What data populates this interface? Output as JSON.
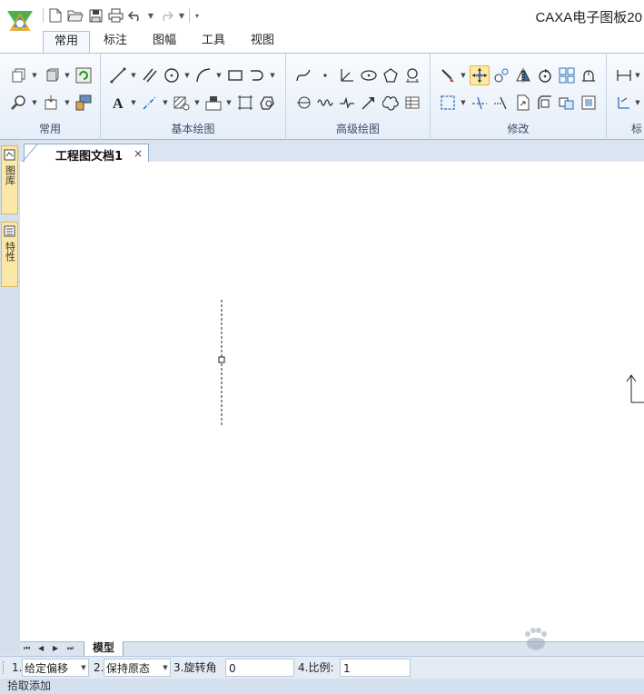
{
  "app": {
    "title": "CAXA电子图板20"
  },
  "quick_access": {
    "new": "new-file-icon",
    "open": "open-folder-icon",
    "save": "save-icon",
    "print": "print-icon",
    "undo": "undo-icon",
    "redo": "redo-icon",
    "customize": "customize-icon"
  },
  "ribbon": {
    "tabs": [
      {
        "label": "常用",
        "active": true
      },
      {
        "label": "标注",
        "active": false
      },
      {
        "label": "图幅",
        "active": false
      },
      {
        "label": "工具",
        "active": false
      },
      {
        "label": "视图",
        "active": false
      }
    ],
    "groups": [
      {
        "label": "常用"
      },
      {
        "label": "基本绘图"
      },
      {
        "label": "高级绘图"
      },
      {
        "label": "修改"
      },
      {
        "label": "标"
      }
    ]
  },
  "left_dock": {
    "panels": [
      {
        "label": "图库",
        "icon": "library-icon"
      },
      {
        "label": "特性",
        "icon": "properties-icon"
      }
    ]
  },
  "document": {
    "tab_label": "工程图文档1",
    "close_glyph": "×"
  },
  "sheet_tabs": {
    "active": "模型",
    "nav": [
      "⏮",
      "◀",
      "▶",
      "⏭"
    ]
  },
  "property_bar": {
    "field1_label": "1.",
    "field1_value": "给定偏移",
    "field2_label": "2.",
    "field2_value": "保持原态",
    "field3_label": "3.旋转角",
    "field3_value": "0",
    "field4_label": "4.比例:",
    "field4_value": "1"
  },
  "status": {
    "prompt": "拾取添加"
  },
  "colors": {
    "accent_blue": "#3a6fb5",
    "selected_tool": "#fde9a4",
    "dock_panel": "#fbe8a6"
  }
}
